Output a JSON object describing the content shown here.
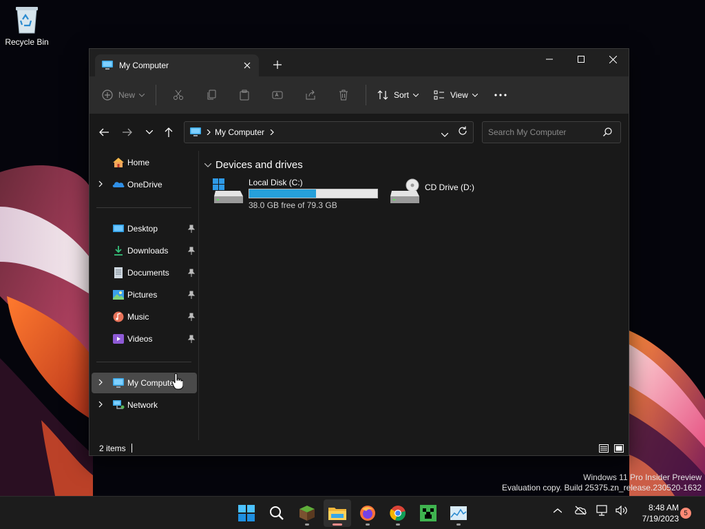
{
  "desktop": {
    "recycle_bin_label": "Recycle Bin",
    "watermark_line1": "Windows 11 Pro Insider Preview",
    "watermark_line2": "Evaluation copy. Build 25375.zn_release.230520-1632"
  },
  "window": {
    "tab_title": "My Computer",
    "toolbar": {
      "new_label": "New",
      "sort_label": "Sort",
      "view_label": "View"
    },
    "address": {
      "crumb": "My Computer"
    },
    "search": {
      "placeholder": "Search My Computer"
    },
    "sidebar": {
      "top_items": [
        {
          "label": "Home",
          "icon": "home-icon"
        },
        {
          "label": "OneDrive",
          "icon": "onedrive-icon"
        }
      ],
      "pinned_items": [
        {
          "label": "Desktop",
          "icon": "desktop-icon"
        },
        {
          "label": "Downloads",
          "icon": "download-icon"
        },
        {
          "label": "Documents",
          "icon": "document-icon"
        },
        {
          "label": "Pictures",
          "icon": "pictures-icon"
        },
        {
          "label": "Music",
          "icon": "music-icon"
        },
        {
          "label": "Videos",
          "icon": "video-icon"
        }
      ],
      "location_items": [
        {
          "label": "My Computer",
          "icon": "computer-icon",
          "selected": true
        },
        {
          "label": "Network",
          "icon": "network-icon"
        }
      ]
    },
    "content": {
      "section_title": "Devices and drives",
      "drives": [
        {
          "name": "Local Disk (C:)",
          "free_text": "38.0 GB free of 79.3 GB",
          "used_fraction": 0.52,
          "icon": "local-disk-icon"
        },
        {
          "name": "CD Drive (D:)",
          "icon": "cd-drive-icon"
        }
      ]
    },
    "status": {
      "item_count": "2 items"
    }
  },
  "taskbar": {
    "apps": [
      "start-icon",
      "search-icon",
      "minecraft-icon",
      "file-explorer-icon",
      "firefox-icon",
      "chrome-icon",
      "creeper-icon",
      "task-manager-icon"
    ],
    "clock_time": "8:48 AM",
    "clock_date": "7/19/2023",
    "notification_count": "5"
  },
  "colors": {
    "accent": "#26a0da",
    "window_bg": "#191919",
    "toolbar_bg": "#2c2c2c",
    "selected_bg": "#4a4a4a"
  }
}
